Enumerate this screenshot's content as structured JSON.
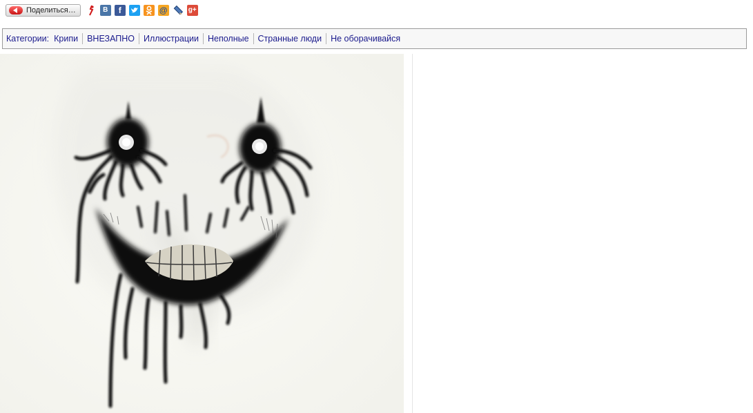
{
  "share": {
    "button_label": "Поделиться…",
    "icons": [
      "yaru-icon",
      "vkontakte-icon",
      "facebook-icon",
      "twitter-icon",
      "odnoklassniki-icon",
      "mailru-icon",
      "livejournal-icon",
      "googleplus-icon"
    ]
  },
  "categories": {
    "label": "Категории:",
    "items": [
      "Крипи",
      "ВНЕЗАПНО",
      "Иллюстрации",
      "Неполные",
      "Странные люди",
      "Не оборачивайся"
    ]
  },
  "colors": {
    "link": "#1a1a8c",
    "bar_bg": "#f7f7f7",
    "bar_border": "#9a9a9a",
    "vk": "#4a76a8",
    "facebook": "#3b5998",
    "twitter": "#1da1f2",
    "odnoklassniki": "#f7931e",
    "mailru": "#f5a623",
    "googleplus": "#dd4b39"
  }
}
